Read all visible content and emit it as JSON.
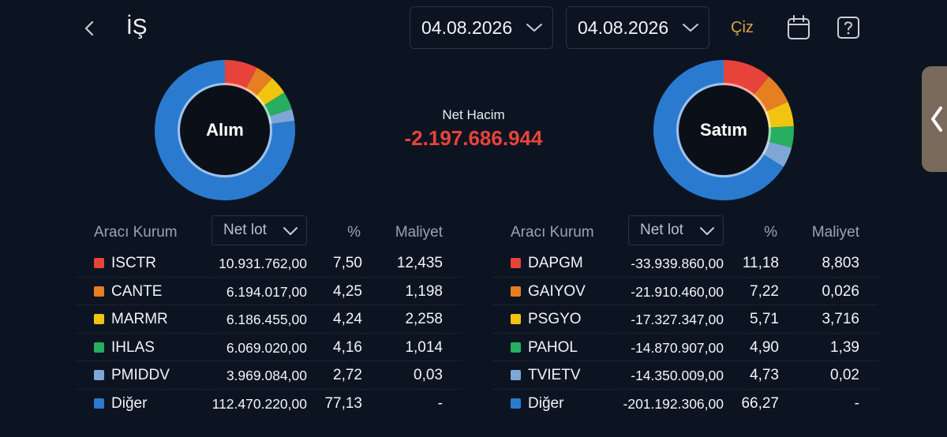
{
  "header": {
    "title": "İŞ",
    "date_start": "04.08.2026",
    "date_end": "04.08.2026",
    "draw_label": "Çiz"
  },
  "summary": {
    "net_label": "Net Hacim",
    "net_value": "-2.197.686.944"
  },
  "buy": {
    "label": "Alım",
    "col_broker": "Aracı Kurum",
    "col_lot": "Net lot",
    "col_pct": "%",
    "col_cost": "Maliyet",
    "rows": [
      {
        "name": "ISCTR",
        "lot": "10.931.762,00",
        "pct": "7,50",
        "cost": "12,435",
        "color": "#e8433a"
      },
      {
        "name": "CANTE",
        "lot": "6.194.017,00",
        "pct": "4,25",
        "cost": "1,198",
        "color": "#e67e22"
      },
      {
        "name": "MARMR",
        "lot": "6.186.455,00",
        "pct": "4,24",
        "cost": "2,258",
        "color": "#f1c40f"
      },
      {
        "name": "IHLAS",
        "lot": "6.069.020,00",
        "pct": "4,16",
        "cost": "1,014",
        "color": "#27ae60"
      },
      {
        "name": "PMIDDV",
        "lot": "3.969.084,00",
        "pct": "2,72",
        "cost": "0,03",
        "color": "#7fa7d6"
      },
      {
        "name": "Diğer",
        "lot": "112.470.220,00",
        "pct": "77,13",
        "cost": "-",
        "color": "#2a7bd0"
      }
    ],
    "shares": [
      7.5,
      4.25,
      4.24,
      4.16,
      2.72,
      77.13
    ]
  },
  "sell": {
    "label": "Satım",
    "col_broker": "Aracı Kurum",
    "col_lot": "Net lot",
    "col_pct": "%",
    "col_cost": "Maliyet",
    "rows": [
      {
        "name": "DAPGM",
        "lot": "-33.939.860,00",
        "pct": "11,18",
        "cost": "8,803",
        "color": "#e8433a"
      },
      {
        "name": "GAIYOV",
        "lot": "-21.910.460,00",
        "pct": "7,22",
        "cost": "0,026",
        "color": "#e67e22"
      },
      {
        "name": "PSGYO",
        "lot": "-17.327.347,00",
        "pct": "5,71",
        "cost": "3,716",
        "color": "#f1c40f"
      },
      {
        "name": "PAHOL",
        "lot": "-14.870.907,00",
        "pct": "4,90",
        "cost": "1,39",
        "color": "#27ae60"
      },
      {
        "name": "TVIETV",
        "lot": "-14.350.009,00",
        "pct": "4,73",
        "cost": "0,02",
        "color": "#7fa7d6"
      },
      {
        "name": "Diğer",
        "lot": "-201.192.306,00",
        "pct": "66,27",
        "cost": "-",
        "color": "#2a7bd0"
      }
    ],
    "shares": [
      11.18,
      7.22,
      5.71,
      4.9,
      4.73,
      66.27
    ]
  }
}
